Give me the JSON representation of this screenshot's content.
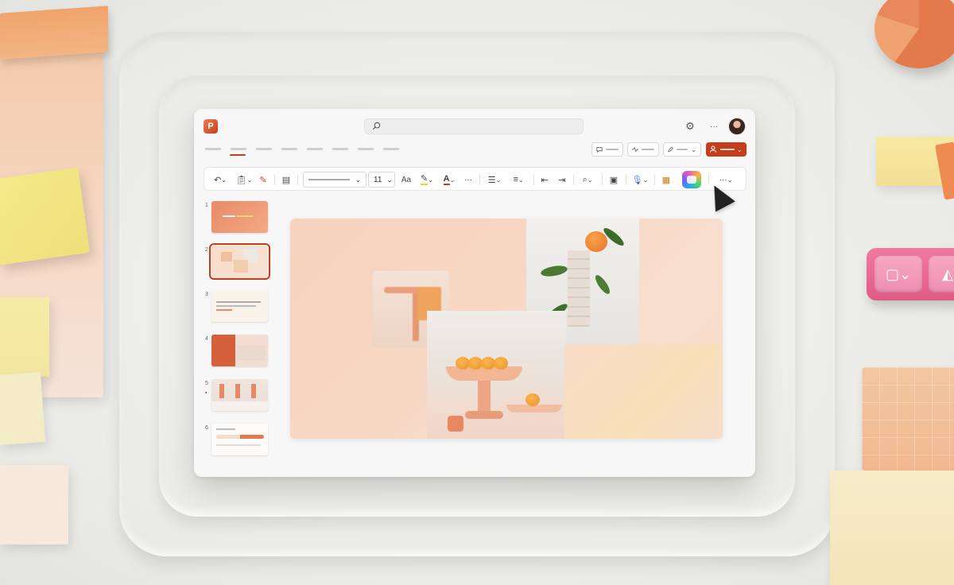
{
  "app": {
    "logo_letter": "P",
    "logo_color": "#c43e1c",
    "accent_color": "#c43e1c",
    "search_placeholder": ""
  },
  "icons": {
    "search": "search-icon",
    "settings": "gear-icon",
    "more": "more-horizontal-icon",
    "comment": "comment-icon",
    "activity": "activity-icon",
    "editing": "pencil-icon",
    "share": "share-person-icon",
    "undo": "undo-icon",
    "paste": "clipboard-icon",
    "format_painter": "brush-icon",
    "new_slide": "new-slide-icon",
    "font_size_change": "font-size-icon",
    "highlight": "highlighter-icon",
    "font_color": "font-color-icon",
    "bullets": "bullets-icon",
    "align": "align-icon",
    "indent_decrease": "decrease-indent-icon",
    "indent_increase": "increase-indent-icon",
    "find": "find-icon",
    "designer": "designer-icon",
    "dictate": "microphone-icon",
    "add_in": "add-ins-icon",
    "copilot": "copilot-icon",
    "cursor": "pointer-cursor-icon"
  },
  "ribbon": {
    "font_size": "11",
    "font_size_label": "Aa",
    "more_label": "···"
  },
  "top": {
    "settings_glyph": "⚙",
    "more_glyph": "···"
  },
  "slides": {
    "numbers": [
      "1",
      "2",
      "3",
      "4",
      "5",
      "6"
    ],
    "selected_index": 2
  }
}
